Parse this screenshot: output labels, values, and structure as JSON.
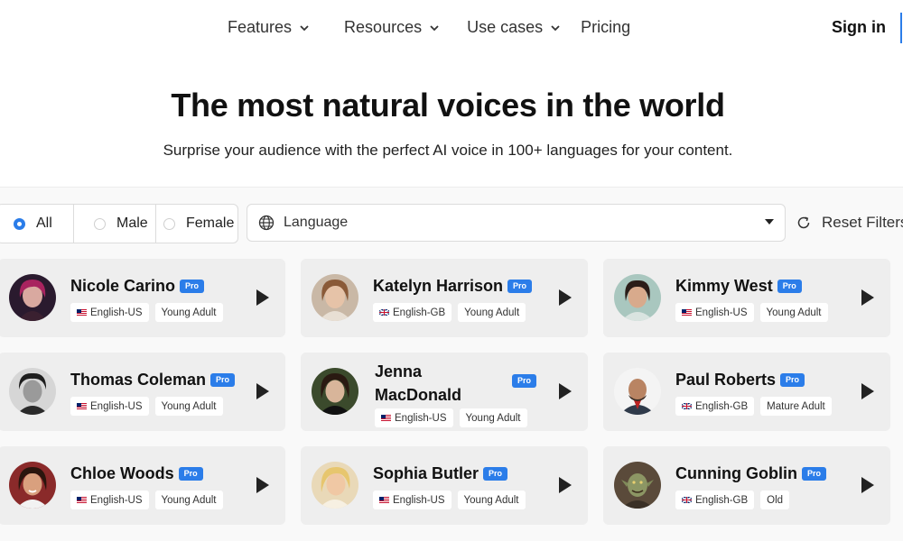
{
  "nav": {
    "items": [
      {
        "label": "Features",
        "icon": "chevron-down-icon"
      },
      {
        "label": "Resources",
        "icon": "chevron-down-icon"
      },
      {
        "label": "Use cases",
        "icon": "chevron-down-icon"
      },
      {
        "label": "Pricing"
      }
    ],
    "signin": "Sign in"
  },
  "hero": {
    "title": "The most natural voices in the world",
    "subtitle": "Surprise your audience with the perfect AI voice in 100+ languages for your content."
  },
  "filters": {
    "gender": [
      {
        "label": "All",
        "selected": true
      },
      {
        "label": "Male",
        "selected": false
      },
      {
        "label": "Female",
        "selected": false
      }
    ],
    "language_placeholder": "Language",
    "reset_label": "Reset Filters"
  },
  "colors": {
    "accent": "#2b7de9",
    "card_bg": "#eeeeee",
    "section_bg": "#f9f9f9"
  },
  "voices": [
    {
      "name": "Nicole Carino",
      "badge": "Pro",
      "language": "English-US",
      "flag": "us-flag-icon",
      "age": "Young Adult"
    },
    {
      "name": "Katelyn Harrison",
      "badge": "Pro",
      "language": "English-GB",
      "flag": "gb-flag-icon",
      "age": "Young Adult"
    },
    {
      "name": "Kimmy West",
      "badge": "Pro",
      "language": "English-US",
      "flag": "us-flag-icon",
      "age": "Young Adult"
    },
    {
      "name": "Thomas Coleman",
      "badge": "Pro",
      "language": "English-US",
      "flag": "us-flag-icon",
      "age": "Young Adult"
    },
    {
      "name": "Jenna MacDonald",
      "badge": "Pro",
      "language": "English-US",
      "flag": "us-flag-icon",
      "age": "Young Adult"
    },
    {
      "name": "Paul Roberts",
      "badge": "Pro",
      "language": "English-GB",
      "flag": "gb-flag-icon",
      "age": "Mature Adult"
    },
    {
      "name": "Chloe Woods",
      "badge": "Pro",
      "language": "English-US",
      "flag": "us-flag-icon",
      "age": "Young Adult"
    },
    {
      "name": "Sophia Butler",
      "badge": "Pro",
      "language": "English-US",
      "flag": "us-flag-icon",
      "age": "Young Adult"
    },
    {
      "name": "Cunning Goblin",
      "badge": "Pro",
      "language": "English-GB",
      "flag": "gb-flag-icon",
      "age": "Old"
    }
  ]
}
